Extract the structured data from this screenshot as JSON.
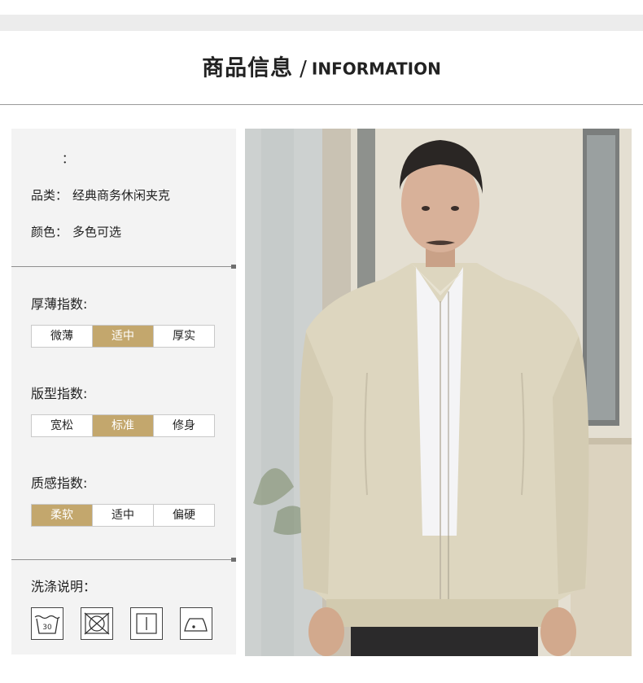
{
  "header": {
    "title_cn": "商品信息",
    "separator": "/",
    "title_en": "INFORMATION"
  },
  "product": {
    "blank_field": "：",
    "category_label": "品类：",
    "category_value": "经典商务休闲夹克",
    "color_label": "颜色：",
    "color_value": "多色可选"
  },
  "indices": [
    {
      "title": "厚薄指数:",
      "options": [
        "微薄",
        "适中",
        "厚实"
      ],
      "selected": 1
    },
    {
      "title": "版型指数:",
      "options": [
        "宽松",
        "标准",
        "修身"
      ],
      "selected": 1
    },
    {
      "title": "质感指数:",
      "options": [
        "柔软",
        "适中",
        "偏硬"
      ],
      "selected": 0
    }
  ],
  "washing": {
    "title": "洗涤说明：",
    "icons": [
      {
        "name": "wash-30-icon",
        "text": "30"
      },
      {
        "name": "do-not-tumble-dry-icon"
      },
      {
        "name": "line-dry-icon"
      },
      {
        "name": "iron-low-icon"
      }
    ]
  },
  "colors": {
    "accent": "#c3a76d",
    "panel": "#f3f3f3",
    "jacket": "#ddd6bf"
  }
}
